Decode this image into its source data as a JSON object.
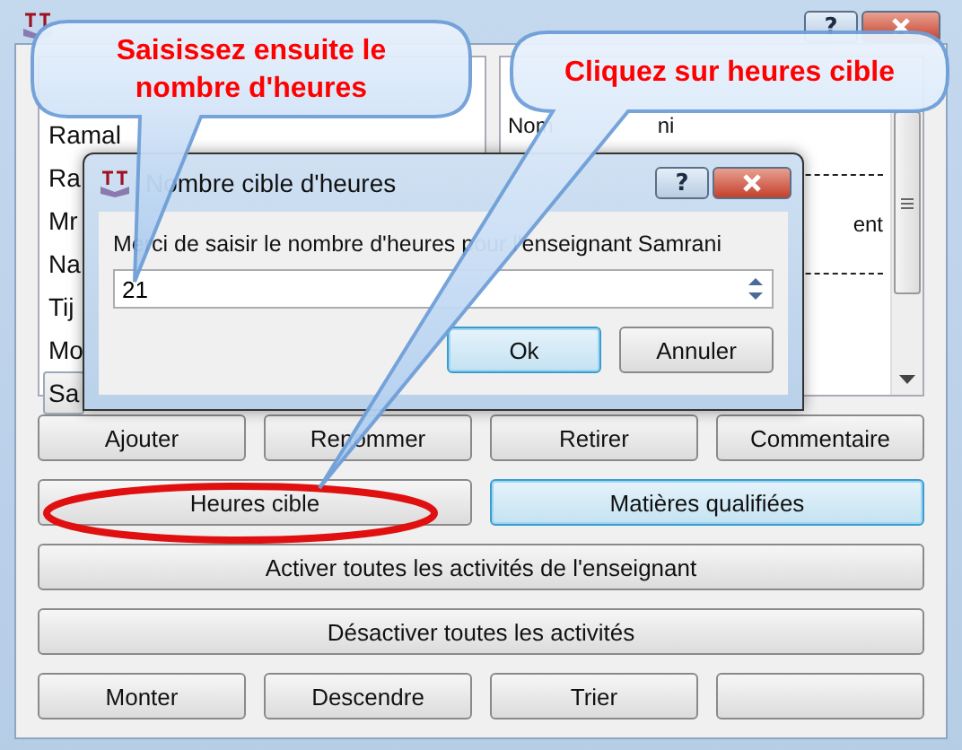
{
  "callouts": [
    {
      "text": "Saisissez ensuite le nombre d'heures"
    },
    {
      "text": "Cliquez sur heures cible"
    }
  ],
  "main_window": {
    "help_button": "?",
    "teachers": [
      {
        "name": "Ramal",
        "selected": false
      },
      {
        "name": "Ra",
        "selected": false
      },
      {
        "name": "Mr",
        "selected": false
      },
      {
        "name": "Na",
        "selected": false
      },
      {
        "name": "Tij",
        "selected": false
      },
      {
        "name": "Mo",
        "selected": false
      },
      {
        "name": "Sa",
        "selected": true
      }
    ],
    "details": [
      {
        "kind": "pair",
        "parts": [
          "Nom",
          "ni"
        ]
      },
      {
        "kind": "rule"
      },
      {
        "kind": "fragment",
        "text": "ent"
      },
      {
        "kind": "rule"
      }
    ],
    "button_rows": [
      [
        {
          "label": "Ajouter",
          "focused": false
        },
        {
          "label": "Renommer",
          "focused": false
        },
        {
          "label": "Retirer",
          "focused": false
        },
        {
          "label": "Commentaire",
          "focused": false
        }
      ],
      [
        {
          "label": "Heures cible",
          "focused": false,
          "circled": true
        },
        {
          "label": "Matières qualifiées",
          "focused": true
        }
      ],
      [
        {
          "label": "Activer toutes les activités de l'enseignant",
          "focused": false
        }
      ],
      [
        {
          "label": "Désactiver toutes les activités",
          "focused": false
        }
      ],
      [
        {
          "label": "Monter",
          "focused": false
        },
        {
          "label": "Descendre",
          "focused": false
        },
        {
          "label": "Trier",
          "focused": false
        },
        {
          "focused": false
        }
      ]
    ]
  },
  "dialog": {
    "title": "Nombre cible d'heures",
    "help_button": "?",
    "prompt": "Merci de saisir le nombre d'heures pour l'enseignant Samrani",
    "value": "21",
    "buttons": [
      {
        "label": "Ok",
        "focused": true
      },
      {
        "label": "Annuler",
        "focused": false
      }
    ]
  }
}
